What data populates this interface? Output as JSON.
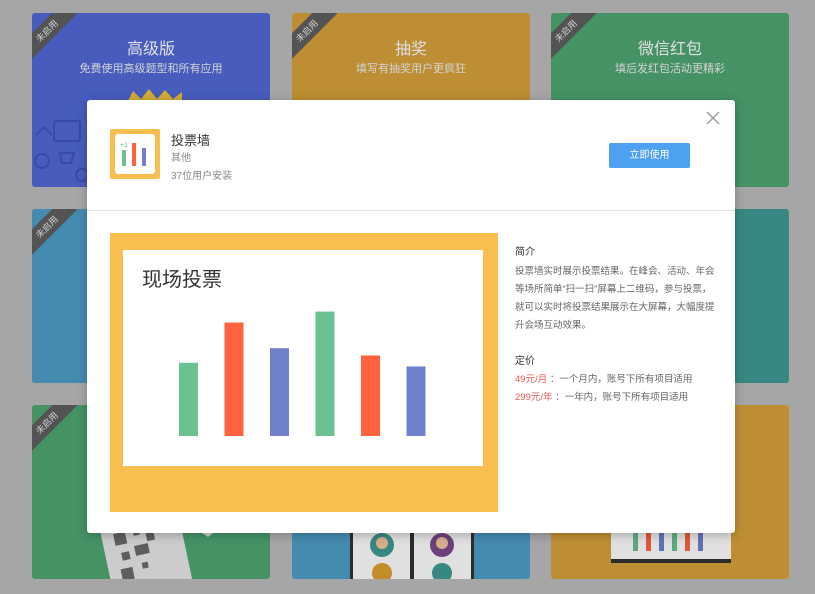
{
  "cards": [
    {
      "badge": "未启用",
      "title": "高级版",
      "subtitle": "免费使用高级题型和所有应用",
      "color": "#5169d8"
    },
    {
      "badge": "未启用",
      "title": "抽奖",
      "subtitle": "填写有抽奖用户更疯狂",
      "color": "#d8a23c"
    },
    {
      "badge": "未启用",
      "title": "微信红包",
      "subtitle": "填后发红包活动更精彩",
      "color": "#4fa774"
    },
    {
      "badge": "未启用",
      "title": "",
      "subtitle": "",
      "color": "#4f9fc9"
    },
    {
      "badge": "",
      "title": "",
      "subtitle": "",
      "color": "#4f9fc9"
    },
    {
      "badge": "",
      "title": "",
      "subtitle": "",
      "color": "#3f9a95"
    },
    {
      "badge": "未启用",
      "title": "",
      "subtitle": "",
      "color": "#4fa774"
    },
    {
      "badge": "",
      "title": "",
      "subtitle": "",
      "color": "#4f9fc9"
    },
    {
      "badge": "",
      "title": "",
      "subtitle": "",
      "color": "#d8a23c"
    }
  ],
  "modal": {
    "app_name": "投票墙",
    "category": "其他",
    "installs": "37位用户安装",
    "use_button": "立即使用",
    "preview_title": "现场投票",
    "preview_bars": [
      {
        "value": 60,
        "color": "#6cc190"
      },
      {
        "value": 93,
        "color": "#ff623f"
      },
      {
        "value": 72,
        "color": "#7180cd"
      },
      {
        "value": 102,
        "color": "#6cc190"
      },
      {
        "value": 66,
        "color": "#ff623f"
      },
      {
        "value": 57,
        "color": "#7180cd"
      }
    ],
    "intro_heading": "简介",
    "intro_text": "投票墙实时展示投票结果。在峰会、活动、年会等场所简单“扫一扫”屏幕上二维码，参与投票，就可以实时将投票结果展示在大屏幕，大幅度提升会场互动效果。",
    "pricing_heading": "定价",
    "prices": [
      {
        "price": "49元/月",
        "desc": " ：一个月内，账号下所有项目适用"
      },
      {
        "price": "299元/年",
        "desc": " ：一年内，账号下所有项目适用"
      }
    ]
  },
  "colors": {
    "accent": "#4ea1f0",
    "preview_bg": "#f8be4f",
    "price": "#e85a4f"
  },
  "icons": {
    "close": "close-icon",
    "app": "bar-chart-icon"
  }
}
